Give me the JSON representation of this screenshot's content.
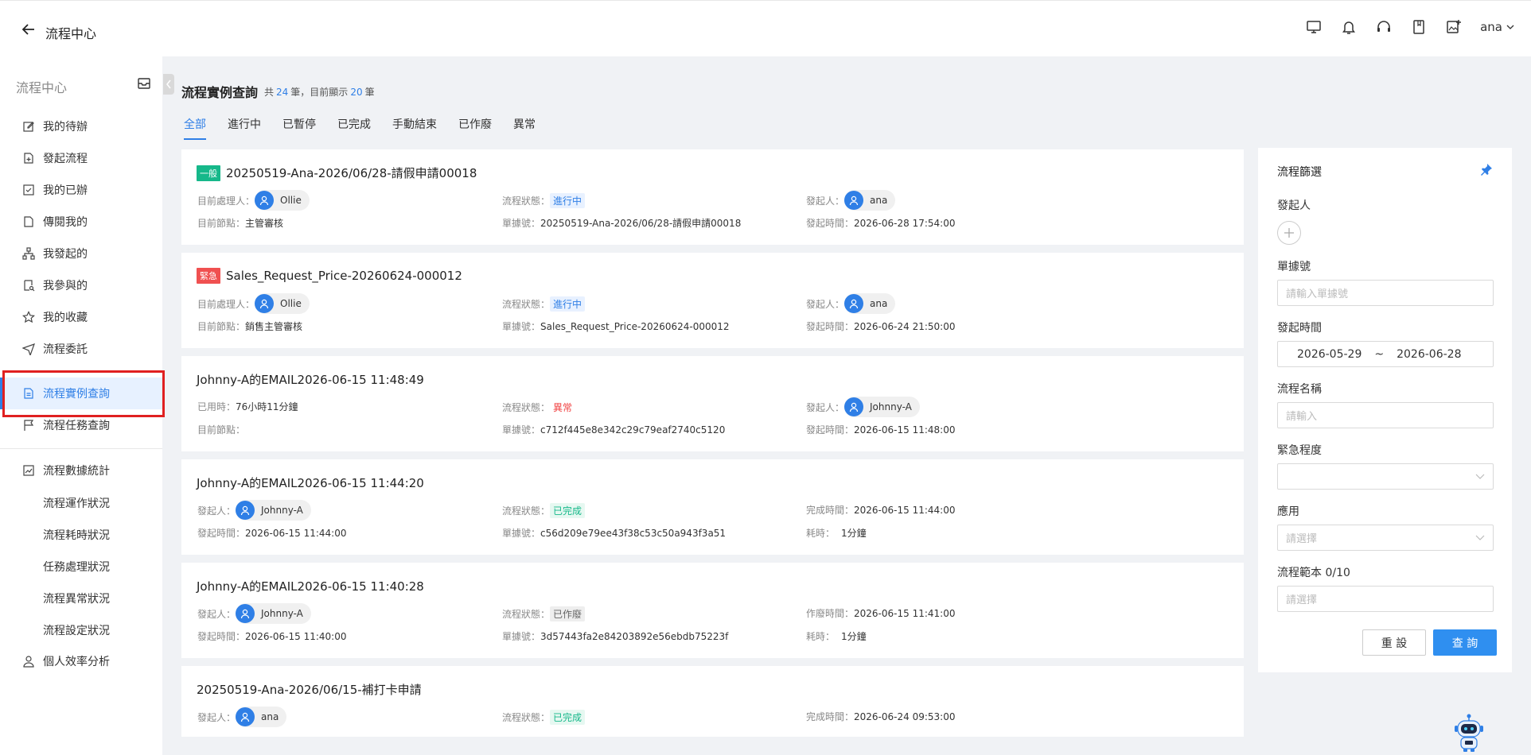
{
  "header": {
    "app_title": "流程中心",
    "user_name": "ana"
  },
  "sidebar": {
    "heading": "流程中心",
    "items": [
      {
        "label": "我的待辦",
        "icon": "edit-icon"
      },
      {
        "label": "發起流程",
        "icon": "file-add-icon"
      },
      {
        "label": "我的已辦",
        "icon": "check-square-icon"
      },
      {
        "label": "傳閱我的",
        "icon": "file-icon"
      },
      {
        "label": "我發起的",
        "icon": "org-chart-icon"
      },
      {
        "label": "我參與的",
        "icon": "file-search-icon"
      },
      {
        "label": "我的收藏",
        "icon": "star-icon"
      },
      {
        "label": "流程委託",
        "icon": "send-icon"
      },
      {
        "label": "流程實例查詢",
        "icon": "document-icon",
        "active": true
      },
      {
        "label": "流程任務查詢",
        "icon": "flag-icon"
      },
      {
        "label": "流程數據統計",
        "icon": "line-chart-icon"
      }
    ],
    "sub_items": [
      "流程運作狀況",
      "流程耗時狀況",
      "任務處理狀況",
      "流程異常狀況",
      "流程設定狀況"
    ],
    "last_item": {
      "label": "個人效率分析",
      "icon": "user-icon"
    }
  },
  "main": {
    "title": "流程實例查詢",
    "count_prefix": "共",
    "total": "24",
    "count_mid": "筆，目前顯示",
    "shown": "20",
    "count_suffix": "筆",
    "tabs": [
      "全部",
      "進行中",
      "已暫停",
      "已完成",
      "手動結束",
      "已作廢",
      "異常"
    ]
  },
  "cards": [
    {
      "tag": "一般",
      "title": "20250519-Ana-2026/06/28-請假申請00018",
      "c1a_label": "目前處理人：",
      "c1a_user": "Ollie",
      "c1b_label": "目前節點：",
      "c1b_value": "主管審核",
      "c2a_label": "流程狀態：",
      "c2a_status": "進行中",
      "c2b_label": "單據號：",
      "c2b_value": "20250519-Ana-2026/06/28-請假申請00018",
      "c3a_label": "發起人：",
      "c3a_user": "ana",
      "c3b_label": "發起時間：",
      "c3b_value": "2026-06-28 17:54:00"
    },
    {
      "tag": "緊急",
      "title": "Sales_Request_Price-20260624-000012",
      "c1a_label": "目前處理人：",
      "c1a_user": "Ollie",
      "c1b_label": "目前節點：",
      "c1b_value": "銷售主管審核",
      "c2a_label": "流程狀態：",
      "c2a_status": "進行中",
      "c2b_label": "單據號：",
      "c2b_value": "Sales_Request_Price-20260624-000012",
      "c3a_label": "發起人：",
      "c3a_user": "ana",
      "c3b_label": "發起時間：",
      "c3b_value": "2026-06-24 21:50:00"
    },
    {
      "title": "Johnny-A的EMAIL2026-06-15 11:48:49",
      "c1a_label": "已用時：",
      "c1a_value": "76小時11分鐘",
      "c1b_label": "目前節點：",
      "c1b_value": "",
      "c2a_label": "流程狀態：",
      "c2a_status": "異常",
      "c2b_label": "單據號：",
      "c2b_value": "c712f445e8e342c29c79eaf2740c5120",
      "c3a_label": "發起人：",
      "c3a_user": "Johnny-A",
      "c3b_label": "發起時間：",
      "c3b_value": "2026-06-15 11:48:00"
    },
    {
      "title": "Johnny-A的EMAIL2026-06-15 11:44:20",
      "c1a_label": "發起人：",
      "c1a_user": "Johnny-A",
      "c1b_label": "發起時間：",
      "c1b_value": "2026-06-15 11:44:00",
      "c2a_label": "流程狀態：",
      "c2a_status": "已完成",
      "c2b_label": "單據號：",
      "c2b_value": "c56d209e79ee43f38c53c50a943f3a51",
      "c3a_label": "完成時間：",
      "c3a_value": "2026-06-15 11:44:00",
      "c3b_label": "耗時：",
      "c3b_value": "1分鐘"
    },
    {
      "title": "Johnny-A的EMAIL2026-06-15 11:40:28",
      "c1a_label": "發起人：",
      "c1a_user": "Johnny-A",
      "c1b_label": "發起時間：",
      "c1b_value": "2026-06-15 11:40:00",
      "c2a_label": "流程狀態：",
      "c2a_status": "已作廢",
      "c2b_label": "單據號：",
      "c2b_value": "3d57443fa2e84203892e56ebdb75223f",
      "c3a_label": "作廢時間：",
      "c3a_value": "2026-06-15 11:41:00",
      "c3b_label": "耗時：",
      "c3b_value": "1分鐘"
    },
    {
      "title": "20250519-Ana-2026/06/15-補打卡申請",
      "c1a_label": "發起人：",
      "c1a_user": "ana",
      "c2a_label": "流程狀態：",
      "c2a_status": "已完成",
      "c3a_label": "完成時間：",
      "c3a_value": "2026-06-24 09:53:00"
    }
  ],
  "filter": {
    "title": "流程篩選",
    "initiator_label": "發起人",
    "doc_no_label": "單據號",
    "doc_no_placeholder": "請輸入單據號",
    "date_label": "發起時間",
    "date_from": "2026-05-29",
    "date_sep": "~",
    "date_to": "2026-06-28",
    "name_label": "流程名稱",
    "name_placeholder": "請輸入",
    "urgency_label": "緊急程度",
    "app_label": "應用",
    "app_placeholder": "請選擇",
    "template_label": "流程範本 0/10",
    "template_placeholder": "請選擇",
    "reset_label": "重 設",
    "search_label": "查 詢"
  },
  "colors": {
    "accent": "#2f7fe6",
    "tag_normal": "#16b88a",
    "tag_urgent": "#f05050",
    "highlight": "#e02020"
  }
}
